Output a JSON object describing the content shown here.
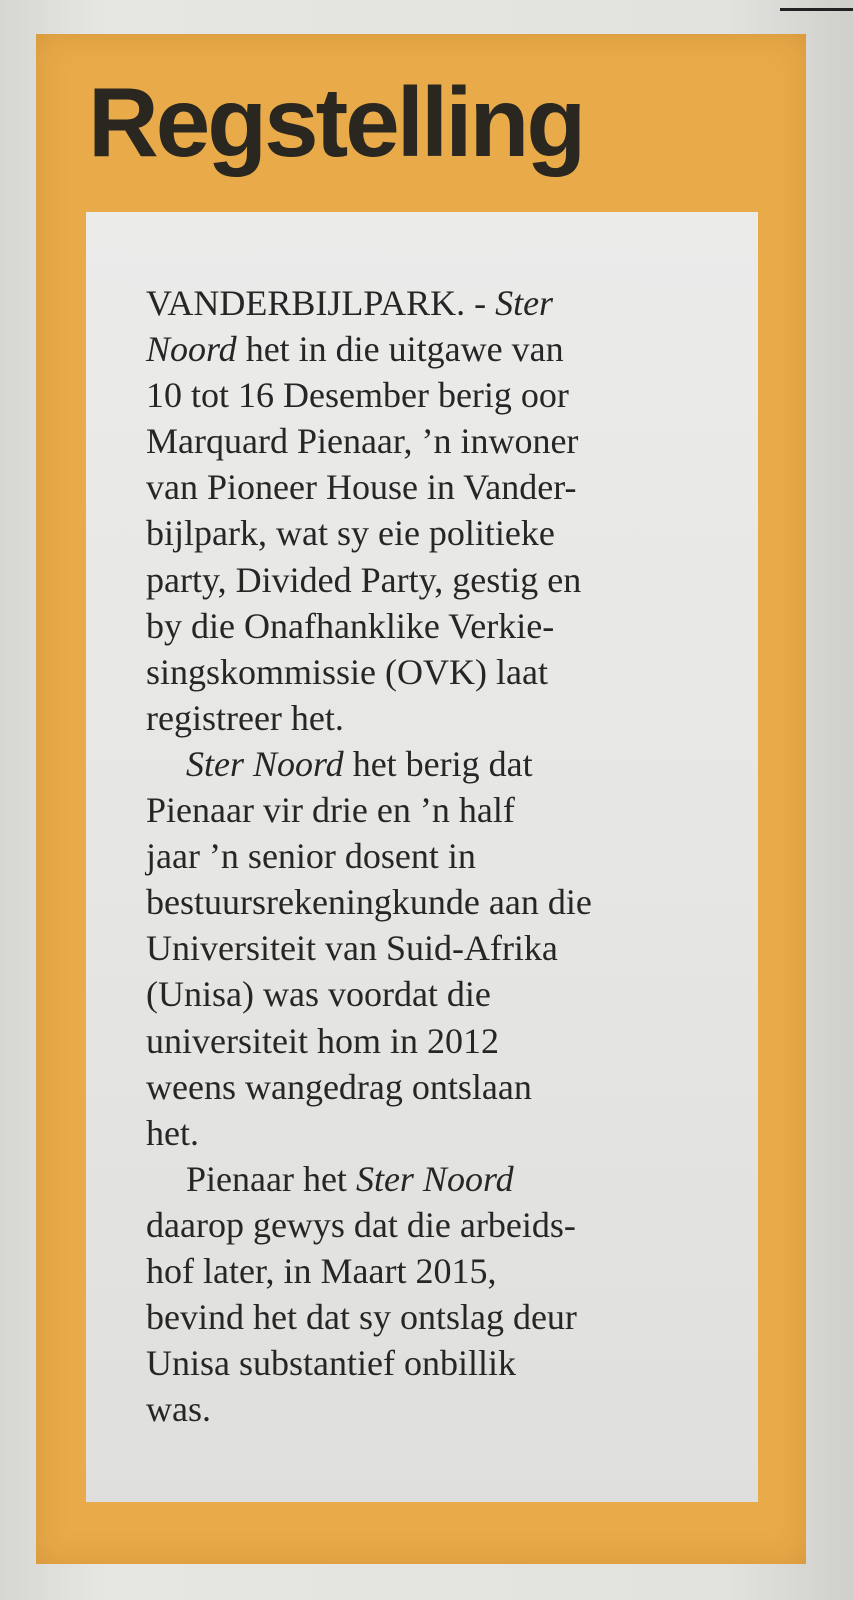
{
  "headline": "Regstelling",
  "lines": [
    {
      "segments": [
        {
          "text": "VANDERBIJLPARK. - ",
          "italic": false
        },
        {
          "text": "Ster",
          "italic": true
        }
      ],
      "indent": false
    },
    {
      "segments": [
        {
          "text": "Noord",
          "italic": true
        },
        {
          "text": " het in die uitgawe van",
          "italic": false
        }
      ],
      "indent": false
    },
    {
      "segments": [
        {
          "text": "10 tot 16 Desember berig oor",
          "italic": false
        }
      ],
      "indent": false
    },
    {
      "segments": [
        {
          "text": "Marquard Pienaar, ’n inwoner",
          "italic": false
        }
      ],
      "indent": false
    },
    {
      "segments": [
        {
          "text": "van Pioneer House in Vander-",
          "italic": false
        }
      ],
      "indent": false
    },
    {
      "segments": [
        {
          "text": "bijlpark, wat sy eie politieke",
          "italic": false
        }
      ],
      "indent": false
    },
    {
      "segments": [
        {
          "text": "party, Divided Party, gestig en",
          "italic": false
        }
      ],
      "indent": false
    },
    {
      "segments": [
        {
          "text": "by die Onafhanklike Verkie-",
          "italic": false
        }
      ],
      "indent": false
    },
    {
      "segments": [
        {
          "text": "singskommissie (OVK) laat",
          "italic": false
        }
      ],
      "indent": false
    },
    {
      "segments": [
        {
          "text": "registreer het.",
          "italic": false
        }
      ],
      "indent": false
    },
    {
      "segments": [
        {
          "text": "Ster Noord",
          "italic": true
        },
        {
          "text": " het berig dat",
          "italic": false
        }
      ],
      "indent": true
    },
    {
      "segments": [
        {
          "text": "Pienaar vir drie en ’n half",
          "italic": false
        }
      ],
      "indent": false
    },
    {
      "segments": [
        {
          "text": "jaar ’n senior dosent in",
          "italic": false
        }
      ],
      "indent": false
    },
    {
      "segments": [
        {
          "text": "bestuursrekeningkunde aan die",
          "italic": false
        }
      ],
      "indent": false
    },
    {
      "segments": [
        {
          "text": "Universiteit van Suid-Afrika",
          "italic": false
        }
      ],
      "indent": false
    },
    {
      "segments": [
        {
          "text": "(Unisa) was voordat die",
          "italic": false
        }
      ],
      "indent": false
    },
    {
      "segments": [
        {
          "text": "universiteit hom in 2012",
          "italic": false
        }
      ],
      "indent": false
    },
    {
      "segments": [
        {
          "text": "weens wangedrag ontslaan",
          "italic": false
        }
      ],
      "indent": false
    },
    {
      "segments": [
        {
          "text": "het.",
          "italic": false
        }
      ],
      "indent": false
    },
    {
      "segments": [
        {
          "text": "Pienaar het ",
          "italic": false
        },
        {
          "text": "Ster Noord",
          "italic": true
        }
      ],
      "indent": true
    },
    {
      "segments": [
        {
          "text": "daarop gewys dat die arbeids-",
          "italic": false
        }
      ],
      "indent": false
    },
    {
      "segments": [
        {
          "text": "hof later, in Maart 2015,",
          "italic": false
        }
      ],
      "indent": false
    },
    {
      "segments": [
        {
          "text": "bevind het dat sy ontslag deur",
          "italic": false
        }
      ],
      "indent": false
    },
    {
      "segments": [
        {
          "text": "Unisa substantief onbillik",
          "italic": false
        }
      ],
      "indent": false
    },
    {
      "segments": [
        {
          "text": "was.",
          "italic": false
        }
      ],
      "indent": false
    }
  ],
  "colors": {
    "frame": "#e9ab49",
    "text_panel": "#e9e9e8",
    "headline_text": "#2a2620",
    "body_text": "#262626"
  }
}
